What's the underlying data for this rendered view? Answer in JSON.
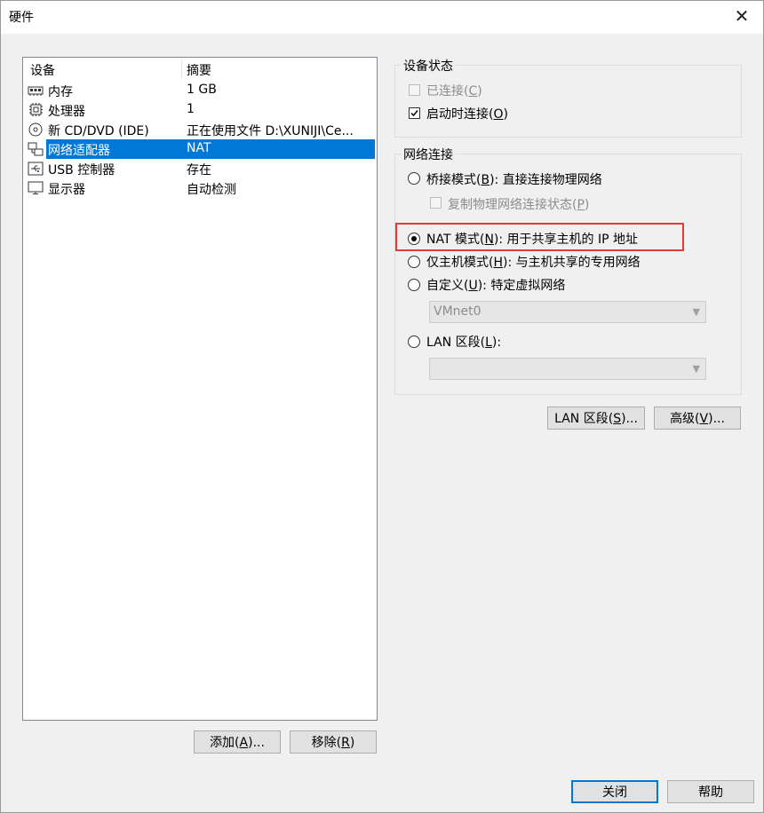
{
  "window": {
    "title": "硬件",
    "close_glyph": "✕"
  },
  "device_list": {
    "headers": {
      "device": "设备",
      "summary": "摘要"
    },
    "items": [
      {
        "icon": "memory-icon",
        "name": "内存",
        "summary": "1 GB",
        "selected": false
      },
      {
        "icon": "processor-icon",
        "name": "处理器",
        "summary": "1",
        "selected": false
      },
      {
        "icon": "cd-dvd-icon",
        "name": "新 CD/DVD (IDE)",
        "summary": "正在使用文件 D:\\XUNIJI\\Ce...",
        "selected": false
      },
      {
        "icon": "network-adapter-icon",
        "name": "网络适配器",
        "summary": "NAT",
        "selected": true
      },
      {
        "icon": "usb-icon",
        "name": "USB 控制器",
        "summary": "存在",
        "selected": false
      },
      {
        "icon": "display-icon",
        "name": "显示器",
        "summary": "自动检测",
        "selected": false
      }
    ]
  },
  "buttons": {
    "add": {
      "text": "添加(",
      "key": "A",
      "tail": ")..."
    },
    "remove": {
      "text": "移除(",
      "key": "R",
      "tail": ")"
    },
    "lan_segments": {
      "text": "LAN 区段(",
      "key": "S",
      "tail": ")..."
    },
    "advanced": {
      "text": "高级(",
      "key": "V",
      "tail": ")..."
    },
    "close": "关闭",
    "help": "帮助"
  },
  "device_status": {
    "legend": "设备状态",
    "connected": {
      "text": "已连接(",
      "key": "C",
      "tail": ")",
      "checked": false,
      "disabled": true
    },
    "connect_on_power": {
      "text": "启动时连接(",
      "key": "O",
      "tail": ")",
      "checked": true,
      "disabled": false
    }
  },
  "network_connection": {
    "legend": "网络连接",
    "bridged": {
      "text": "桥接模式(",
      "key": "B",
      "tail": "): 直接连接物理网络",
      "selected": false
    },
    "replicate": {
      "text": "复制物理网络连接状态(",
      "key": "P",
      "tail": ")",
      "checked": false,
      "disabled": true
    },
    "nat": {
      "text": "NAT 模式(",
      "key": "N",
      "tail": "): 用于共享主机的 IP 地址",
      "selected": true
    },
    "host_only": {
      "text": "仅主机模式(",
      "key": "H",
      "tail": "): 与主机共享的专用网络",
      "selected": false
    },
    "custom": {
      "text": "自定义(",
      "key": "U",
      "tail": "): 特定虚拟网络",
      "selected": false
    },
    "custom_value": "VMnet0",
    "lan_segment": {
      "text": "LAN 区段(",
      "key": "L",
      "tail": "):",
      "selected": false
    },
    "lan_value": ""
  },
  "colors": {
    "highlight": "#e53935",
    "selection": "#0078d7"
  }
}
